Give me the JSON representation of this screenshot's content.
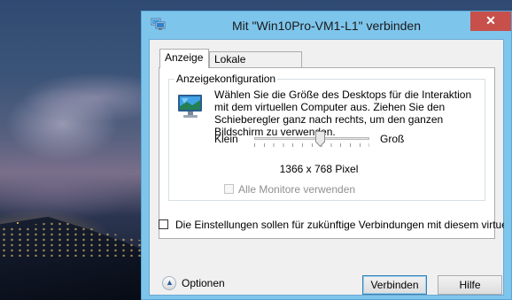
{
  "window": {
    "title": "Mit \"Win10Pro-VM1-L1\" verbinden",
    "close_glyph": "✕"
  },
  "tabs": [
    {
      "label": "Anzeige",
      "active": true
    },
    {
      "label": "Lokale Ressourcen",
      "active": false
    }
  ],
  "display_group": {
    "legend": "Anzeigekonfiguration",
    "description": "Wählen Sie die Größe des Desktops für die Interaktion mit dem virtuellen Computer aus. Ziehen Sie den Schieberegler ganz nach rechts, um den ganzen Bildschirm zu verwenden.",
    "slider_min_label": "Klein",
    "slider_max_label": "Groß",
    "slider_position": 0.58,
    "resolution": "1366 x 768 Pixel",
    "all_monitors_label": "Alle Monitore verwenden",
    "all_monitors_checked": false,
    "all_monitors_enabled": false
  },
  "persist_settings": {
    "label": "Die Einstellungen sollen für zukünftige Verbindungen mit diesem virtuellen C",
    "checked": false
  },
  "footer": {
    "options_label": "Optionen",
    "connect_label": "Verbinden",
    "help_label": "Hilfe"
  },
  "icons": {
    "title_icon": "remote-desktop-icon",
    "monitor_icon": "monitor-icon",
    "options_toggle": "chevron-up-icon"
  },
  "colors": {
    "window_frame": "#7ec5ec",
    "close_button": "#c7504b"
  }
}
